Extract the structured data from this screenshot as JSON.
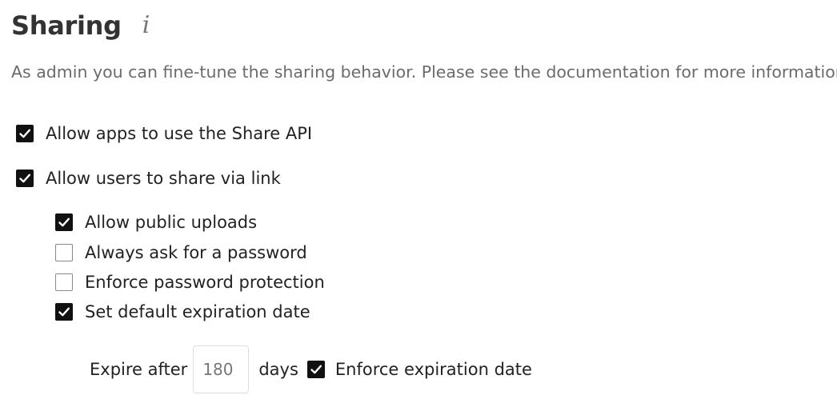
{
  "header": {
    "title": "Sharing",
    "info_icon": "info-icon",
    "info_glyph": "i"
  },
  "description": "As admin you can fine-tune the sharing behavior. Please see the documentation for more information.",
  "options": {
    "share_api": {
      "label": "Allow apps to use the Share API",
      "checked": true
    },
    "share_via_link": {
      "label": "Allow users to share via link",
      "checked": true
    },
    "public_uploads": {
      "label": "Allow public uploads",
      "checked": true
    },
    "ask_password": {
      "label": "Always ask for a password",
      "checked": false
    },
    "enforce_password": {
      "label": "Enforce password protection",
      "checked": false
    },
    "default_expiration": {
      "label": "Set default expiration date",
      "checked": true
    },
    "enforce_expiration": {
      "label": "Enforce expiration date",
      "checked": true
    }
  },
  "expiration": {
    "prefix_label": "Expire after",
    "days_value": "180",
    "suffix_label": "days"
  },
  "colors": {
    "checkbox_checked": "#111111",
    "muted_text": "#6b6b6b"
  }
}
